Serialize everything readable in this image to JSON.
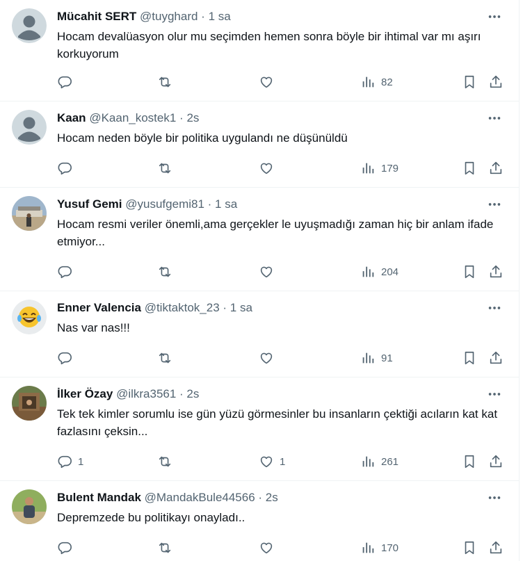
{
  "tweets": [
    {
      "name": "Mücahit SERT",
      "handle": "@tuyghard",
      "dot": " · ",
      "time": "1 sa",
      "text": "Hocam devalüasyon olur mu seçimden hemen sonra böyle bir ihtimal var mı aşırı korkuyorum",
      "replies": "",
      "retweets": "",
      "likes": "",
      "views": "82",
      "avatar": "default-avatar"
    },
    {
      "name": "Kaan",
      "handle": "@Kaan_kostek1",
      "dot": " · ",
      "time": "2s",
      "text": "Hocam neden böyle bir politika uygulandı ne düşünüldü",
      "replies": "",
      "retweets": "",
      "likes": "",
      "views": "179",
      "avatar": "default-avatar"
    },
    {
      "name": "Yusuf Gemi",
      "handle": "@yusufgemi81",
      "dot": " · ",
      "time": "1 sa",
      "text": "Hocam resmi veriler önemli,ama gerçekler le uyuşmadığı zaman hiç bir anlam ifade etmiyor...",
      "replies": "",
      "retweets": "",
      "likes": "",
      "views": "204",
      "avatar": "photo-avatar"
    },
    {
      "name": "Enner Valencia",
      "handle": "@tiktaktok_23",
      "dot": " · ",
      "time": "1 sa",
      "text": "Nas var nas!!!",
      "replies": "",
      "retweets": "",
      "likes": "",
      "views": "91",
      "avatar": "laughing-emoji-avatar"
    },
    {
      "name": "İlker Özay",
      "handle": "@ilkra3561",
      "dot": " · ",
      "time": "2s",
      "text": "Tek tek kimler sorumlu ise gün yüzü görmesinler bu insanların çektiği acıların kat kat fazlasını çeksin...",
      "replies": "1",
      "retweets": "",
      "likes": "1",
      "views": "261",
      "avatar": "photo-avatar"
    },
    {
      "name": "Bulent Mandak",
      "handle": "@MandakBule44566",
      "dot": " · ",
      "time": "2s",
      "text": "Depremzede bu politikayı onayladı..",
      "replies": "",
      "retweets": "",
      "likes": "",
      "views": "170",
      "avatar": "photo-avatar"
    }
  ],
  "colors": {
    "text": "#0f1419",
    "muted": "#536471",
    "border": "#eff3f4"
  }
}
